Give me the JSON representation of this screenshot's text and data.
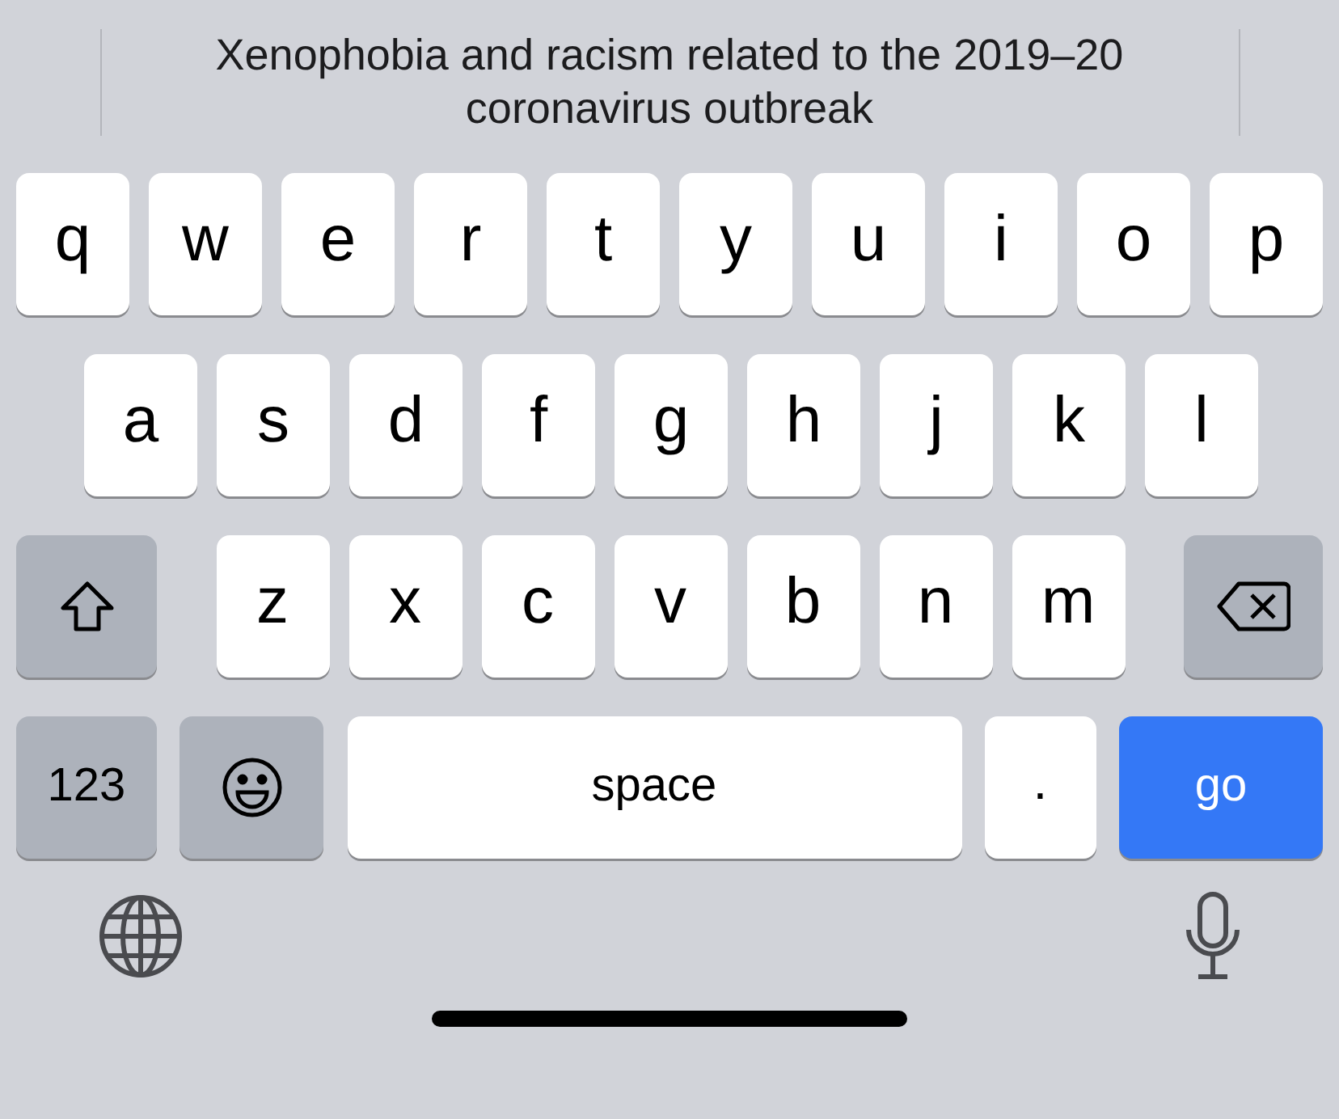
{
  "suggestion": {
    "text": "Xenophobia and racism related to the 2019–20 coronavirus outbreak"
  },
  "rows": [
    {
      "keys": [
        {
          "kind": "letter",
          "label": "q"
        },
        {
          "kind": "letter",
          "label": "w"
        },
        {
          "kind": "letter",
          "label": "e"
        },
        {
          "kind": "letter",
          "label": "r"
        },
        {
          "kind": "letter",
          "label": "t"
        },
        {
          "kind": "letter",
          "label": "y"
        },
        {
          "kind": "letter",
          "label": "u"
        },
        {
          "kind": "letter",
          "label": "i"
        },
        {
          "kind": "letter",
          "label": "o"
        },
        {
          "kind": "letter",
          "label": "p"
        }
      ]
    },
    {
      "keys": [
        {
          "kind": "letter",
          "label": "a"
        },
        {
          "kind": "letter",
          "label": "s"
        },
        {
          "kind": "letter",
          "label": "d"
        },
        {
          "kind": "letter",
          "label": "f"
        },
        {
          "kind": "letter",
          "label": "g"
        },
        {
          "kind": "letter",
          "label": "h"
        },
        {
          "kind": "letter",
          "label": "j"
        },
        {
          "kind": "letter",
          "label": "k"
        },
        {
          "kind": "letter",
          "label": "l"
        }
      ]
    },
    {
      "keys": [
        {
          "kind": "shift"
        },
        {
          "kind": "letter",
          "label": "z"
        },
        {
          "kind": "letter",
          "label": "x"
        },
        {
          "kind": "letter",
          "label": "c"
        },
        {
          "kind": "letter",
          "label": "v"
        },
        {
          "kind": "letter",
          "label": "b"
        },
        {
          "kind": "letter",
          "label": "n"
        },
        {
          "kind": "letter",
          "label": "m"
        },
        {
          "kind": "delete"
        }
      ]
    },
    {
      "keys": [
        {
          "kind": "numbers",
          "label": "123"
        },
        {
          "kind": "emoji"
        },
        {
          "kind": "space",
          "label": "space"
        },
        {
          "kind": "period",
          "label": "."
        },
        {
          "kind": "go",
          "label": "go"
        }
      ]
    }
  ]
}
